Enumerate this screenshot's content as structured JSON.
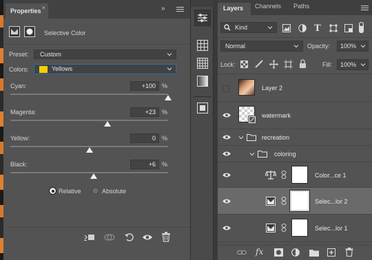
{
  "properties": {
    "tab_title": "Properties",
    "close_glyph": "×",
    "collapse_glyph": "»",
    "adjustment_title": "Selective Color",
    "preset_label": "Preset:",
    "preset_value": "Custom",
    "colors_label": "Colors:",
    "colors_value": "Yellows",
    "colors_swatch": "#f5d000",
    "sliders": [
      {
        "label": "Cyan:",
        "value": "+100",
        "unit": "%",
        "level": 1.0
      },
      {
        "label": "Magenta:",
        "value": "+23",
        "unit": "%",
        "level": 0.615
      },
      {
        "label": "Yellow:",
        "value": "0",
        "unit": "%",
        "level": 0.5
      },
      {
        "label": "Black:",
        "value": "+6",
        "unit": "%",
        "level": 0.53
      }
    ],
    "method_relative": "Relative",
    "method_absolute": "Absolute",
    "method_selected": "Relative"
  },
  "layers_panel": {
    "tabs": [
      "Layers",
      "Channels",
      "Paths"
    ],
    "filter_kind": "Kind",
    "blend_mode": "Normal",
    "opacity_label": "Opacity:",
    "opacity_value": "100%",
    "lock_label": "Lock:",
    "fill_label": "Fill:",
    "fill_value": "100%",
    "layers": [
      {
        "name": "Layer 2",
        "visible": false
      },
      {
        "name": "watermark",
        "visible": true
      },
      {
        "name": "recreation",
        "visible": true,
        "type": "group"
      },
      {
        "name": "coloring",
        "visible": true,
        "type": "group"
      },
      {
        "name": "Color...ce 1",
        "visible": true,
        "type": "color-balance"
      },
      {
        "name": "Selec...lor 2",
        "visible": true,
        "type": "selective-color",
        "selected": true
      },
      {
        "name": "Selec...lor 1",
        "visible": true,
        "type": "selective-color"
      }
    ]
  },
  "colors": {
    "panel_bg": "#535353",
    "selected_row": "#6a6a6a",
    "accent_swatch": "#f5d000"
  }
}
